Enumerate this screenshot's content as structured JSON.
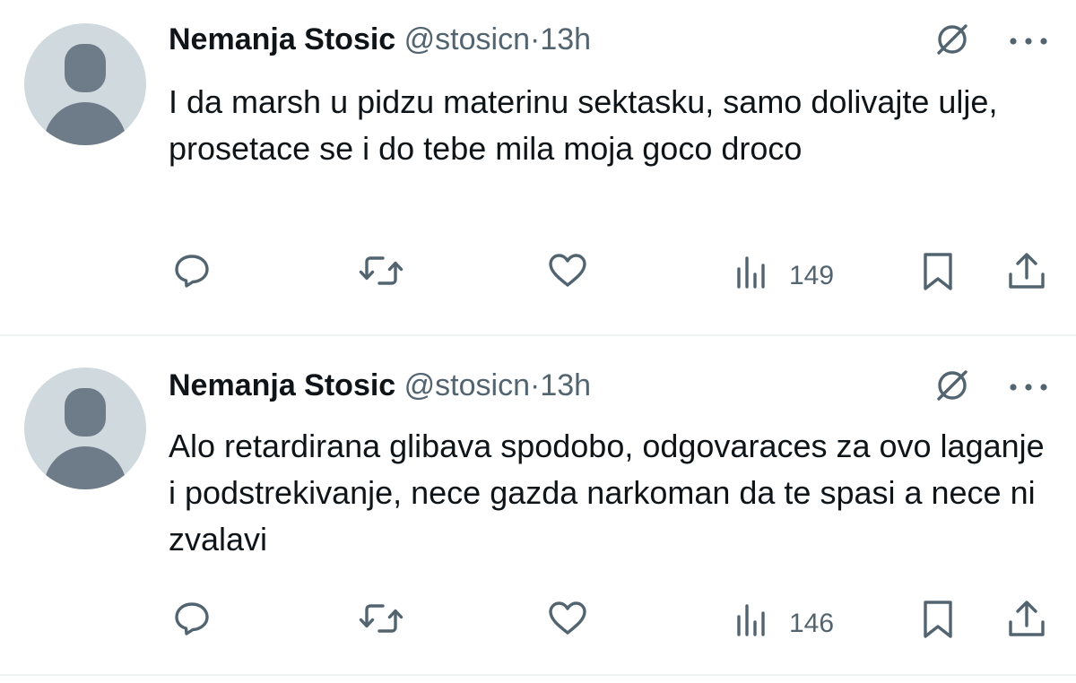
{
  "tweets": [
    {
      "author_name": "Nemanja Stosic",
      "handle": "@stosicn",
      "separator": "·",
      "time": "13h",
      "text": "I da marsh u pidzu materinu sektasku, samo dolivajte ulje, prosetace se i do tebe mila moja goco droco",
      "views": "149"
    },
    {
      "author_name": "Nemanja Stosic",
      "handle": "@stosicn",
      "separator": "·",
      "time": "13h",
      "text": "Alo retardirana glibava spodobo, odgovaraces za ovo laganje i podstrekivanje, nece gazda narkoman da te spasi a nece ni zvalavi",
      "views": "146"
    }
  ],
  "icons": {
    "grok": "grok-icon",
    "more": "more-icon",
    "reply": "reply-icon",
    "retweet": "retweet-icon",
    "like": "heart-icon",
    "views": "views-icon",
    "bookmark": "bookmark-icon",
    "share": "share-icon"
  },
  "colors": {
    "text": "#0f1419",
    "secondary": "#536471",
    "avatar_bg": "#cfd9de",
    "avatar_fg": "#6e7c89",
    "divider": "#eff3f4"
  }
}
